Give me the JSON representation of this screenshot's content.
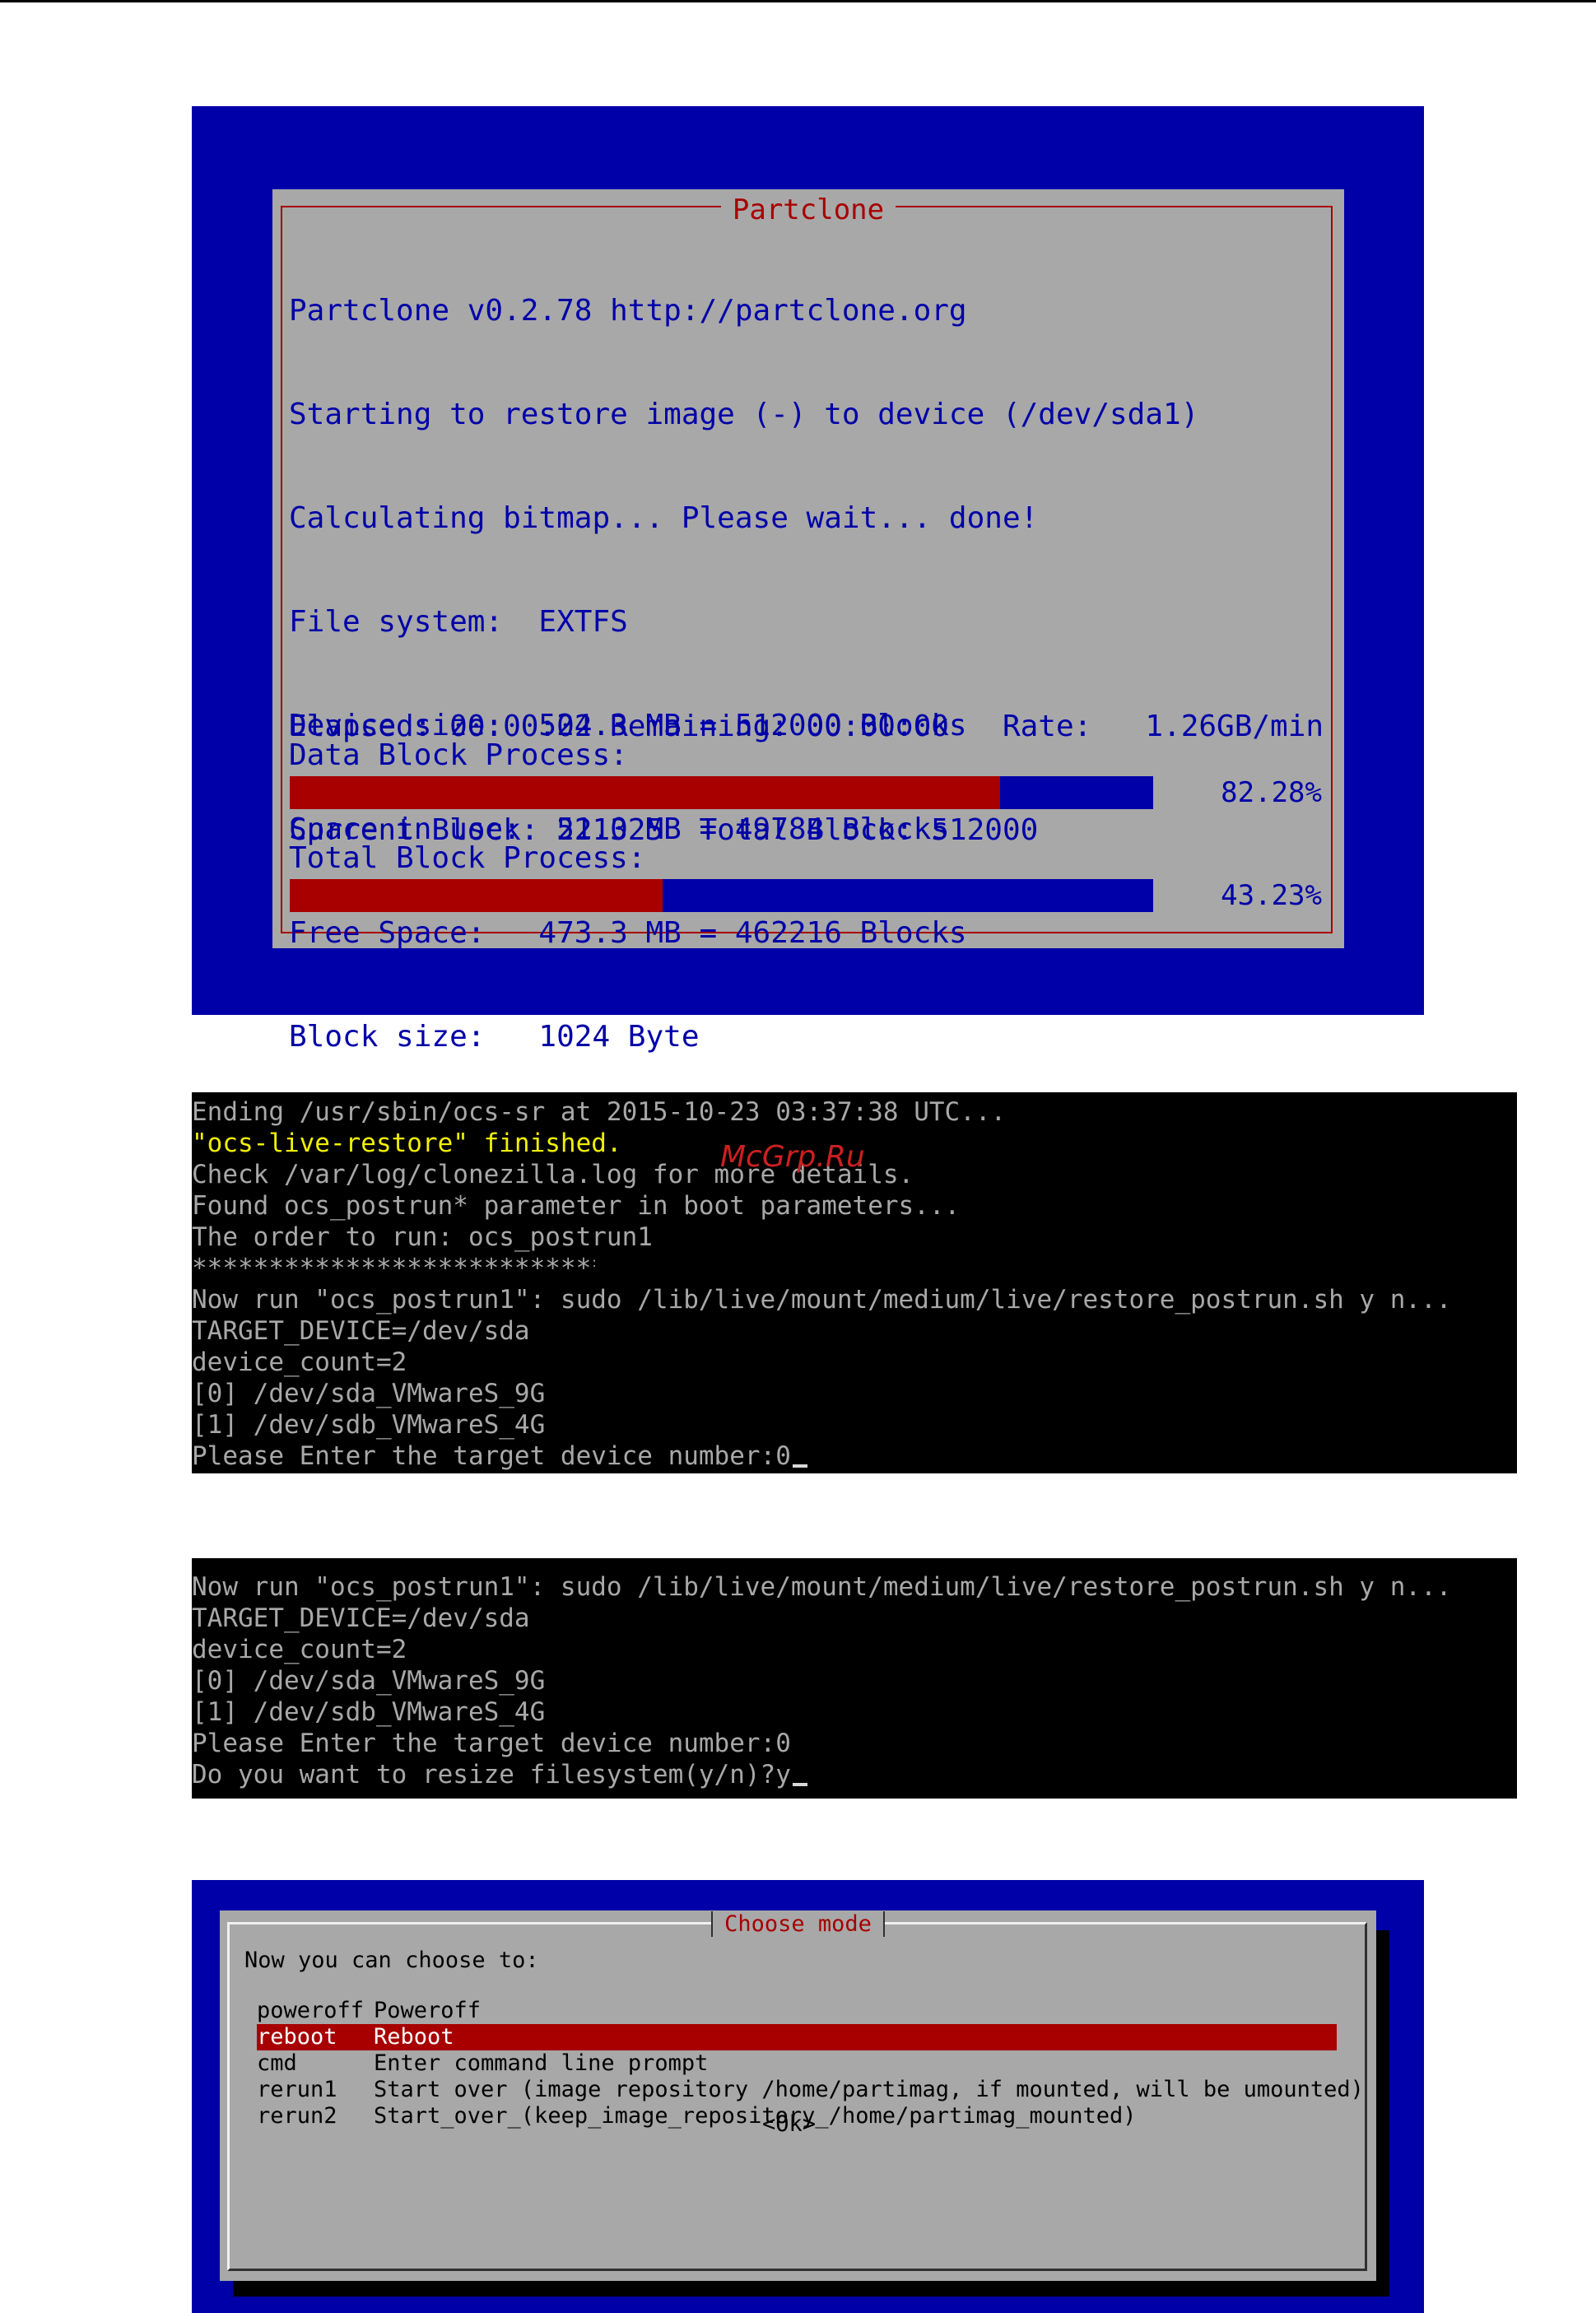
{
  "partclone": {
    "title": "Partclone",
    "lines": [
      "Partclone v0.2.78 http://partclone.org",
      "Starting to restore image (-) to device (/dev/sda1)",
      "Calculating bitmap... Please wait... done!",
      "File system:  EXTFS",
      "Device size:  524.3 MB = 512000 Blocks",
      "Space in use:  51.0 MB = 49784 Blocks",
      "Free Space:   473.3 MB = 462216 Blocks",
      "Block size:   1024 Byte"
    ],
    "elapsed_line": "Elapsed: 00:00:02 Remaining: 00:00:00   Rate:   1.26GB/min",
    "block_line": "Current Block: 221325  Total Block: 512000",
    "data_block_label": "Data Block Process:",
    "data_block_percent": "82.28%",
    "data_block_fraction": 0.8228,
    "total_block_label": "Total Block Process:",
    "total_block_percent": "43.23%",
    "total_block_fraction": 0.4323,
    "colors": {
      "background": "#0000a8",
      "dialog": "#a8a8a8",
      "text": "#0000a8",
      "accent": "#a80000"
    }
  },
  "terminal1": {
    "lines": [
      "Ending /usr/sbin/ocs-sr at 2015-10-23 03:37:38 UTC...",
      "\"ocs-live-restore\" finished.",
      "Check /var/log/clonezilla.log for more details.",
      "Found ocs_postrun* parameter in boot parameters...",
      "The order to run: ocs_postrun1",
      "******************************",
      "Now run \"ocs_postrun1\": sudo /lib/live/mount/medium/live/restore_postrun.sh y n...",
      "TARGET_DEVICE=/dev/sda",
      "device_count=2",
      "[0] /dev/sda_VMwareS_9G",
      "[1] /dev/sdb_VMwareS_4G",
      "Please Enter the target device number:0"
    ],
    "highlight_color": "#f0f000"
  },
  "terminal2": {
    "lines": [
      "******************************",
      "Now run \"ocs_postrun1\": sudo /lib/live/mount/medium/live/restore_postrun.sh y n...",
      "TARGET_DEVICE=/dev/sda",
      "device_count=2",
      "[0] /dev/sda_VMwareS_9G",
      "[1] /dev/sdb_VMwareS_4G",
      "Please Enter the target device number:0",
      "Do you want to resize filesystem(y/n)?y"
    ]
  },
  "watermark": "McGrp.Ru",
  "choose_mode": {
    "title": "Choose mode",
    "prompt": "Now you can choose to:",
    "options": [
      {
        "key": "poweroff",
        "desc": "Poweroff"
      },
      {
        "key": "reboot",
        "desc": "Reboot"
      },
      {
        "key": "cmd",
        "desc": "Enter command line prompt"
      },
      {
        "key": "rerun1",
        "desc": "Start over (image repository /home/partimag, if mounted, will be umounted)"
      },
      {
        "key": "rerun2",
        "desc": "Start_over_(keep_image_repository_/home/partimag_mounted)"
      }
    ],
    "ok_label": "<Ok>",
    "selected_color": "#a80000"
  }
}
